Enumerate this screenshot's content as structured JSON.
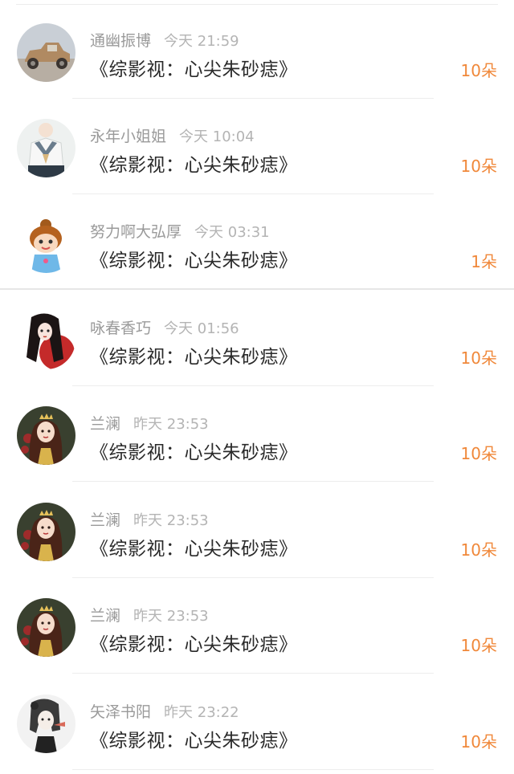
{
  "gifts": [
    {
      "user": "通幽振博",
      "time": "今天 21:59",
      "book": "《综影视：心尖朱砂痣》",
      "amount": "10朵",
      "avatar": "vintage-car-avatar"
    },
    {
      "user": "永年小姐姐",
      "time": "今天 10:04",
      "book": "《综影视：心尖朱砂痣》",
      "amount": "10朵",
      "avatar": "sailor-uniform-avatar"
    },
    {
      "user": "努力啊大弘厚",
      "time": "今天 03:31",
      "book": "《综影视：心尖朱砂痣》",
      "amount": "1朵",
      "avatar": "cartoon-girl-avatar"
    },
    {
      "user": "咏春香巧",
      "time": "今天 01:56",
      "book": "《综影视：心尖朱砂痣》",
      "amount": "10朵",
      "avatar": "red-dress-girl-avatar"
    },
    {
      "user": "兰澜",
      "time": "昨天 23:53",
      "book": "《综影视：心尖朱砂痣》",
      "amount": "10朵",
      "avatar": "princess-avatar"
    },
    {
      "user": "兰澜",
      "time": "昨天 23:53",
      "book": "《综影视：心尖朱砂痣》",
      "amount": "10朵",
      "avatar": "princess-avatar"
    },
    {
      "user": "兰澜",
      "time": "昨天 23:53",
      "book": "《综影视：心尖朱砂痣》",
      "amount": "10朵",
      "avatar": "princess-avatar"
    },
    {
      "user": "矢泽书阳",
      "time": "昨天 23:22",
      "book": "《综影视：心尖朱砂痣》",
      "amount": "10朵",
      "avatar": "sketch-girl-avatar"
    }
  ],
  "colors": {
    "accent": "#f0883a",
    "title_text": "#2a2a2a",
    "meta_text": "#9a9a9a"
  }
}
